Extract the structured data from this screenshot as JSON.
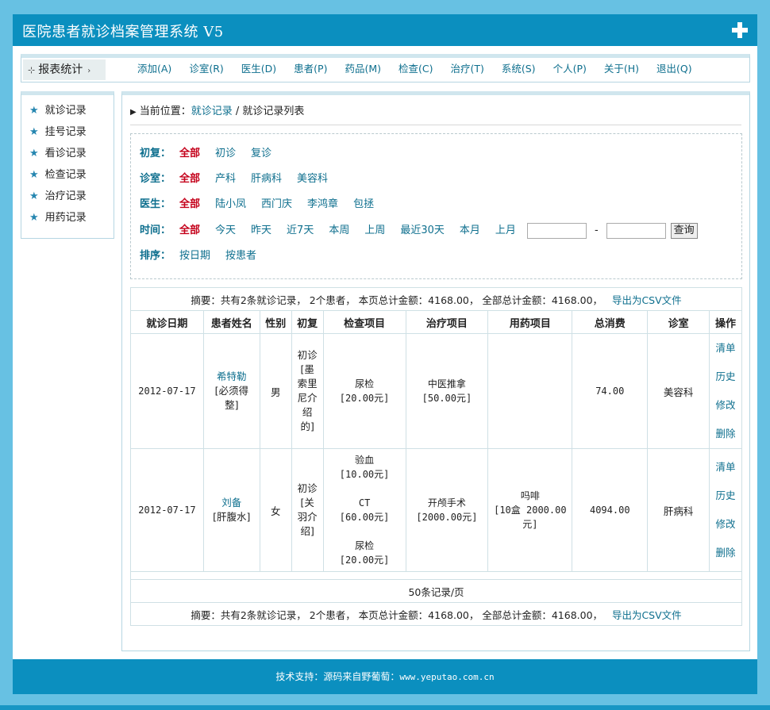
{
  "header": {
    "title": "医院患者就诊档案管理系统 V5"
  },
  "menu": {
    "title": "报表统计",
    "items": [
      "添加(A)",
      "诊室(R)",
      "医生(D)",
      "患者(P)",
      "药品(M)",
      "检查(C)",
      "治疗(T)",
      "系统(S)",
      "个人(P)",
      "关于(H)",
      "退出(Q)"
    ]
  },
  "sidebar": {
    "items": [
      "就诊记录",
      "挂号记录",
      "看诊记录",
      "检查记录",
      "治疗记录",
      "用药记录"
    ]
  },
  "breadcrumb": {
    "prefix": "当前位置：",
    "link": "就诊记录",
    "sep": "/",
    "current": "就诊记录列表"
  },
  "filters": {
    "first_visit": {
      "label": "初复：",
      "options": [
        "全部",
        "初诊",
        "复诊"
      ]
    },
    "clinic": {
      "label": "诊室：",
      "options": [
        "全部",
        "产科",
        "肝病科",
        "美容科"
      ]
    },
    "doctor": {
      "label": "医生：",
      "options": [
        "全部",
        "陆小凤",
        "西门庆",
        "李鸿章",
        "包拯"
      ]
    },
    "time": {
      "label": "时间：",
      "options": [
        "全部",
        "今天",
        "昨天",
        "近7天",
        "本周",
        "上周",
        "最近30天",
        "本月",
        "上月"
      ],
      "dash": "-",
      "query": "查询",
      "start_value": "",
      "end_value": ""
    },
    "sort": {
      "label": "排序：",
      "options": [
        "按日期",
        "按患者"
      ]
    }
  },
  "summary": {
    "text": "摘要：共有2条就诊记录， 2个患者， 本页总计金额：4168.00， 全部总计金额：4168.00，",
    "export": "导出为CSV文件"
  },
  "table": {
    "headers": [
      "就诊日期",
      "患者姓名",
      "性别",
      "初复",
      "检查项目",
      "治疗项目",
      "用药项目",
      "总消费",
      "诊室",
      "操作"
    ],
    "rows": [
      {
        "date": "2012-07-17",
        "name": "希特勒",
        "name_note": "[必须得整]",
        "gender": "男",
        "visit": "初诊[墨索里尼介绍的]",
        "checks": [
          {
            "name": "尿检",
            "price": "[20.00元]"
          }
        ],
        "treatments": [
          {
            "name": "中医推拿",
            "price": "[50.00元]"
          }
        ],
        "meds": [],
        "total": "74.00",
        "clinic": "美容科"
      },
      {
        "date": "2012-07-17",
        "name": "刘备",
        "name_note": "[肝腹水]",
        "gender": "女",
        "visit": "初诊[关羽介绍]",
        "checks": [
          {
            "name": "验血",
            "price": "[10.00元]"
          },
          {
            "name": "CT",
            "price": "[60.00元]"
          },
          {
            "name": "尿检",
            "price": "[20.00元]"
          }
        ],
        "treatments": [
          {
            "name": "开颅手术",
            "price": "[2000.00元]"
          }
        ],
        "meds": [
          {
            "name": "吗啡",
            "price": "[10盒 2000.00元]"
          }
        ],
        "total": "4094.00",
        "clinic": "肝病科"
      }
    ],
    "ops": [
      "清单",
      "历史",
      "修改",
      "删除"
    ],
    "page_size": "50条记录/页"
  },
  "footer": {
    "prefix": "技术支持：源码来自野葡萄：",
    "url": "www.yeputao.com.cn"
  }
}
